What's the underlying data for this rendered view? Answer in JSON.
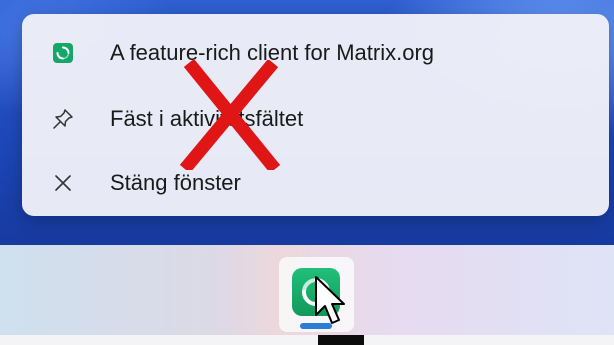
{
  "jump_list": {
    "items": [
      {
        "label": "A feature-rich client for Matrix.org",
        "icon": "app-icon"
      },
      {
        "label": "Fäst i aktivitetsfältet",
        "icon": "pin-icon"
      },
      {
        "label": "Stäng fönster",
        "icon": "close-icon"
      }
    ]
  },
  "overlay": {
    "mark": "red-x-icon",
    "color": "#e01515"
  },
  "taskbar": {
    "app_icon": "element-app-icon",
    "accent": "#17a66a",
    "indicator_color": "#2b7bd8"
  }
}
